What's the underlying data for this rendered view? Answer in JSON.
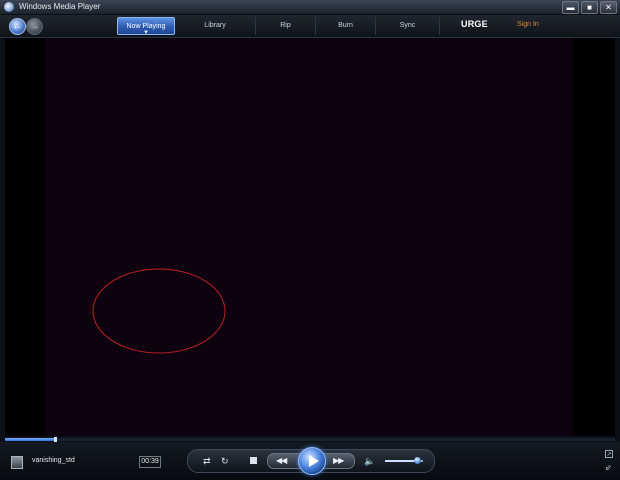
{
  "window": {
    "title": "Windows Media Player",
    "controls": {
      "minimize": "▬",
      "maximize": "■",
      "close": "✕"
    }
  },
  "nav": {
    "back_icon": "back-arrow-icon",
    "forward_icon": "forward-arrow-icon"
  },
  "tabs": [
    {
      "label": "Now Playing",
      "active": true
    },
    {
      "label": "Library",
      "active": false
    },
    {
      "label": "Rip",
      "active": false
    },
    {
      "label": "Burn",
      "active": false
    },
    {
      "label": "Sync",
      "active": false
    }
  ],
  "store": {
    "logo": "URGE",
    "signin": "Sign In",
    "signin_color": "#e08a2e"
  },
  "player": {
    "media_title": "vanishing_std",
    "time": "00:39",
    "seek_progress": 0.08,
    "volume_level": 0.85,
    "shape_color": "#c0201f",
    "accent": "#3d7bd6"
  }
}
